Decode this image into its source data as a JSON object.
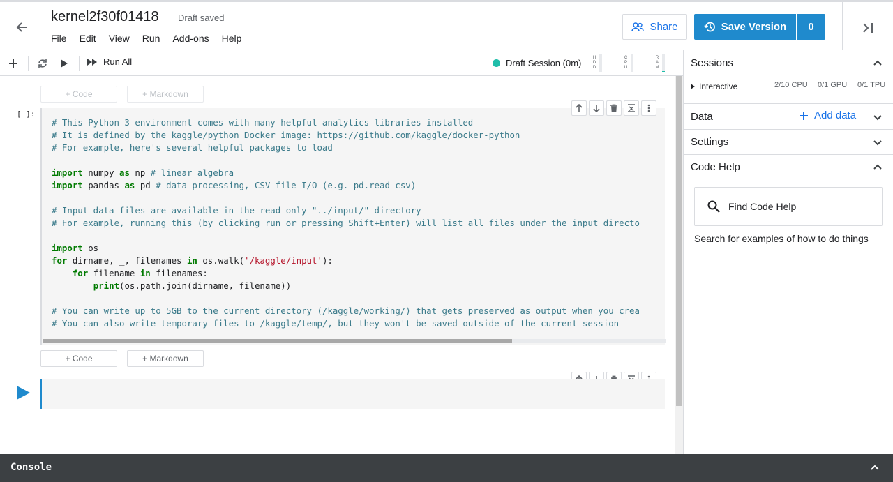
{
  "header": {
    "title": "kernel2f30f01418",
    "status": "Draft saved",
    "menu": [
      "File",
      "Edit",
      "View",
      "Run",
      "Add-ons",
      "Help"
    ],
    "share_label": "Share",
    "save_label": "Save Version",
    "version_count": "0"
  },
  "toolbar": {
    "run_all_label": "Run All",
    "session_label": "Draft Session (0m)",
    "meters": [
      {
        "label": "HDD",
        "fill": 0.0
      },
      {
        "label": "CPU",
        "fill": 0.0
      },
      {
        "label": "RAM",
        "fill": 0.05
      }
    ]
  },
  "notebook": {
    "add_code_label": "+ Code",
    "add_markdown_label": "+ Markdown",
    "exec_count": "[ ]:",
    "code_lines": [
      [
        {
          "t": "c",
          "s": "# This Python 3 environment comes with many helpful analytics libraries installed"
        }
      ],
      [
        {
          "t": "c",
          "s": "# It is defined by the kaggle/python Docker image: https://github.com/kaggle/docker-python"
        }
      ],
      [
        {
          "t": "c",
          "s": "# For example, here's several helpful packages to load"
        }
      ],
      [],
      [
        {
          "t": "k",
          "s": "import"
        },
        {
          "t": "p",
          "s": " numpy "
        },
        {
          "t": "k",
          "s": "as"
        },
        {
          "t": "p",
          "s": " np "
        },
        {
          "t": "c",
          "s": "# linear algebra"
        }
      ],
      [
        {
          "t": "k",
          "s": "import"
        },
        {
          "t": "p",
          "s": " pandas "
        },
        {
          "t": "k",
          "s": "as"
        },
        {
          "t": "p",
          "s": " pd "
        },
        {
          "t": "c",
          "s": "# data processing, CSV file I/O (e.g. pd.read_csv)"
        }
      ],
      [],
      [
        {
          "t": "c",
          "s": "# Input data files are available in the read-only \"../input/\" directory"
        }
      ],
      [
        {
          "t": "c",
          "s": "# For example, running this (by clicking run or pressing Shift+Enter) will list all files under the input directo"
        }
      ],
      [],
      [
        {
          "t": "k",
          "s": "import"
        },
        {
          "t": "p",
          "s": " os"
        }
      ],
      [
        {
          "t": "k",
          "s": "for"
        },
        {
          "t": "p",
          "s": " dirname, _, filenames "
        },
        {
          "t": "k",
          "s": "in"
        },
        {
          "t": "p",
          "s": " os.walk("
        },
        {
          "t": "s",
          "s": "'/kaggle/input'"
        },
        {
          "t": "p",
          "s": "):"
        }
      ],
      [
        {
          "t": "p",
          "s": "    "
        },
        {
          "t": "k",
          "s": "for"
        },
        {
          "t": "p",
          "s": " filename "
        },
        {
          "t": "k",
          "s": "in"
        },
        {
          "t": "p",
          "s": " filenames:"
        }
      ],
      [
        {
          "t": "p",
          "s": "        "
        },
        {
          "t": "k",
          "s": "print"
        },
        {
          "t": "p",
          "s": "(os.path.join(dirname, filename))"
        }
      ],
      [],
      [
        {
          "t": "c",
          "s": "# You can write up to 5GB to the current directory (/kaggle/working/) that gets preserved as output when you crea"
        }
      ],
      [
        {
          "t": "c",
          "s": "# You can also write temporary files to /kaggle/temp/, but they won't be saved outside of the current session"
        }
      ]
    ]
  },
  "right_panel": {
    "sessions_title": "Sessions",
    "interactive_label": "Interactive",
    "cpu_usage": "2/10 CPU",
    "gpu_usage": "0/1 GPU",
    "tpu_usage": "0/1 TPU",
    "data_title": "Data",
    "add_data_label": "Add data",
    "settings_title": "Settings",
    "code_help_title": "Code Help",
    "find_code_help_placeholder": "Find Code Help",
    "code_help_desc": "Search for examples of how to do things"
  },
  "console": {
    "label": "Console"
  },
  "colors": {
    "accent": "#1f8acd",
    "link": "#1a73e8",
    "session_dot": "#20beaa",
    "console_bg": "#3c4043"
  }
}
